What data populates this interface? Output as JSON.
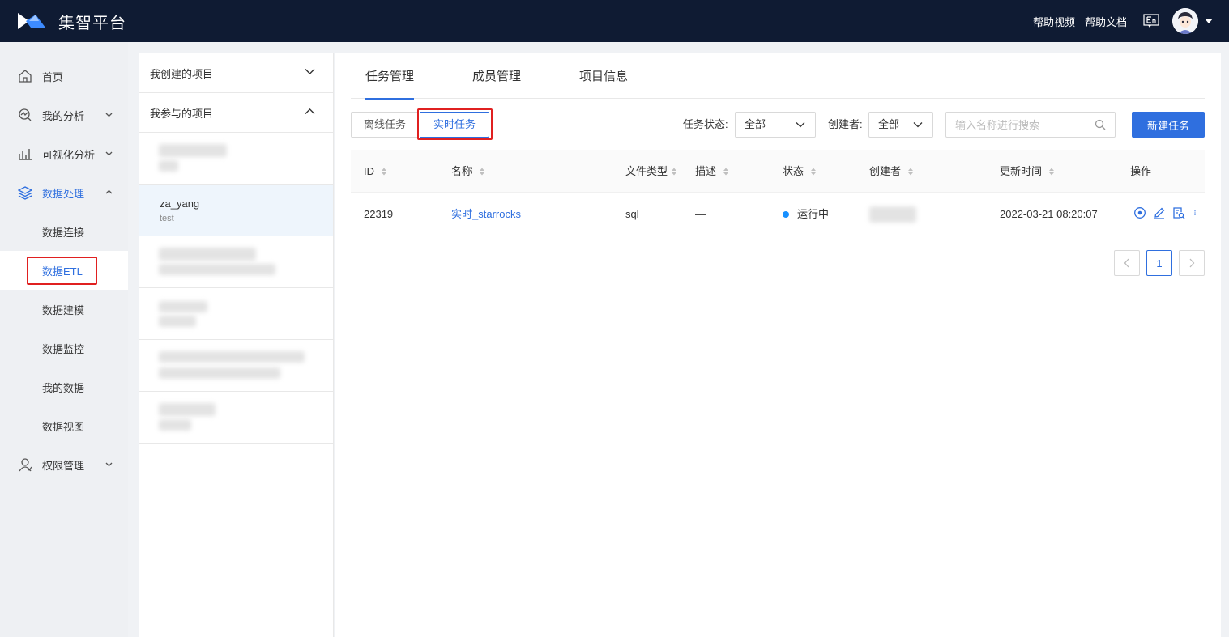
{
  "header": {
    "app_title": "集智平台",
    "help_video": "帮助视频",
    "help_docs": "帮助文档",
    "lang_icon": "language-en-icon"
  },
  "leftnav": {
    "items": [
      {
        "label": "首页",
        "icon": "home-icon"
      },
      {
        "label": "我的分析",
        "icon": "analysis-icon"
      },
      {
        "label": "可视化分析",
        "icon": "bar-chart-icon"
      },
      {
        "label": "数据处理",
        "icon": "layers-icon"
      },
      {
        "label": "权限管理",
        "icon": "user-icon"
      }
    ],
    "sub_items": [
      "数据连接",
      "数据ETL",
      "数据建模",
      "数据监控",
      "我的数据",
      "数据视图"
    ],
    "active_sub": "数据ETL"
  },
  "projects": {
    "created_group": "我创建的项目",
    "joined_group": "我参与的项目",
    "selected": {
      "name": "za_yang",
      "desc": "test"
    }
  },
  "main": {
    "tabs": [
      "任务管理",
      "成员管理",
      "项目信息"
    ],
    "active_tab": "任务管理",
    "segments": [
      "离线任务",
      "实时任务"
    ],
    "active_segment": "实时任务",
    "filters": {
      "status_label": "任务状态:",
      "status_value": "全部",
      "creator_label": "创建者:",
      "creator_value": "全部"
    },
    "search_placeholder": "输入名称进行搜索",
    "new_button": "新建任务",
    "table": {
      "columns": [
        "ID",
        "名称",
        "文件类型",
        "描述",
        "状态",
        "创建者",
        "更新时间",
        "操作"
      ],
      "rows": [
        {
          "id": "22319",
          "name": "实时_starrocks",
          "file_type": "sql",
          "desc": "—",
          "status": "运行中",
          "updated": "2022-03-21 08:20:07"
        }
      ]
    },
    "pagination": {
      "current": "1"
    }
  },
  "colors": {
    "topbar": "#0f1b33",
    "primary": "#2f6fdf",
    "status_running": "#1890ff",
    "highlight_box": "#e02020"
  }
}
